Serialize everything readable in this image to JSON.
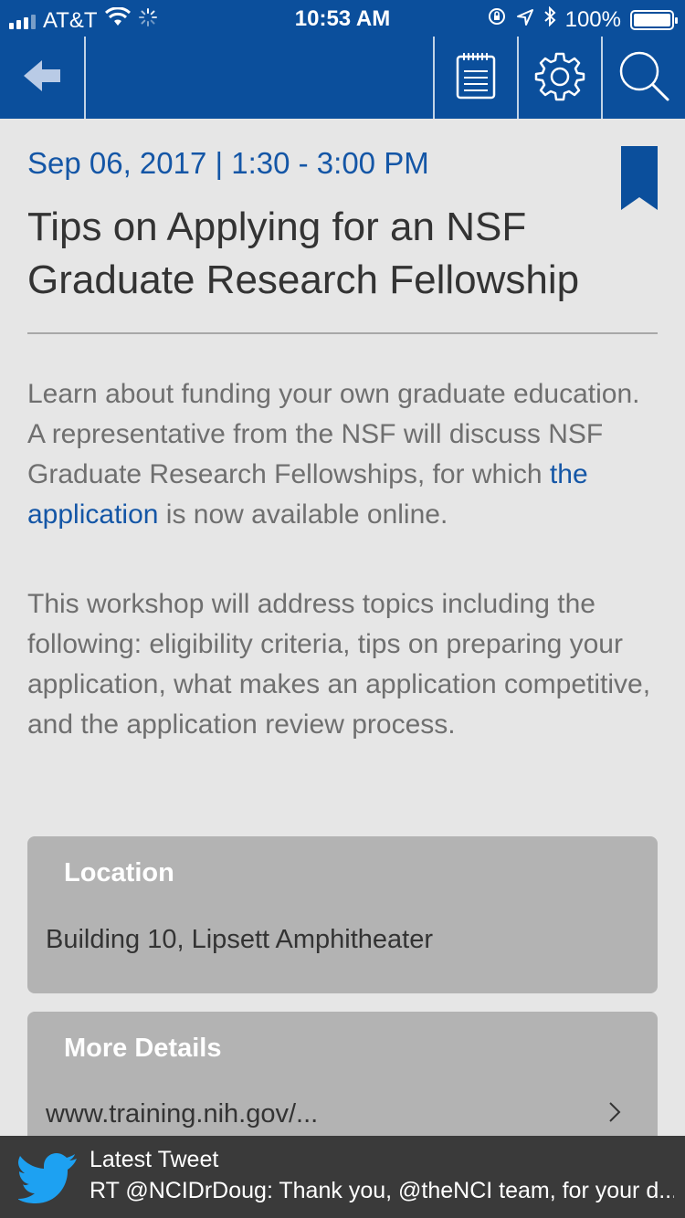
{
  "status_bar": {
    "carrier": "AT&T",
    "time": "10:53 AM",
    "battery": "100%",
    "icons": [
      "signal-icon",
      "wifi-icon",
      "activity-spinner-icon",
      "orientation-lock-icon",
      "location-icon",
      "bluetooth-icon",
      "battery-icon"
    ]
  },
  "nav": {
    "icons": [
      "back-arrow-icon",
      "notepad-icon",
      "gear-icon",
      "search-icon"
    ],
    "accent_color": "#0b4f9c"
  },
  "event": {
    "date": "Sep 06, 2017 | 1:30 - 3:00 PM",
    "title": "Tips on Applying for an NSF Graduate Research Fellowship",
    "description_before_link": "Learn about funding your own graduate education. A representative from the NSF will discuss NSF Graduate Research Fellowships, for which ",
    "description_link": "the application",
    "description_after_link": " is now available online.",
    "description_2": "This workshop will address topics including the following: eligibility criteria, tips on preparing your application, what makes an application competitive, and the application review process."
  },
  "location_card": {
    "title": "Location",
    "value": "Building 10, Lipsett Amphitheater"
  },
  "details_card": {
    "title": "More Details",
    "value": "www.training.nih.gov/..."
  },
  "tweet": {
    "title": "Latest Tweet",
    "text": "RT @NCIDrDoug: Thank you, @theNCI team, for your d..."
  }
}
